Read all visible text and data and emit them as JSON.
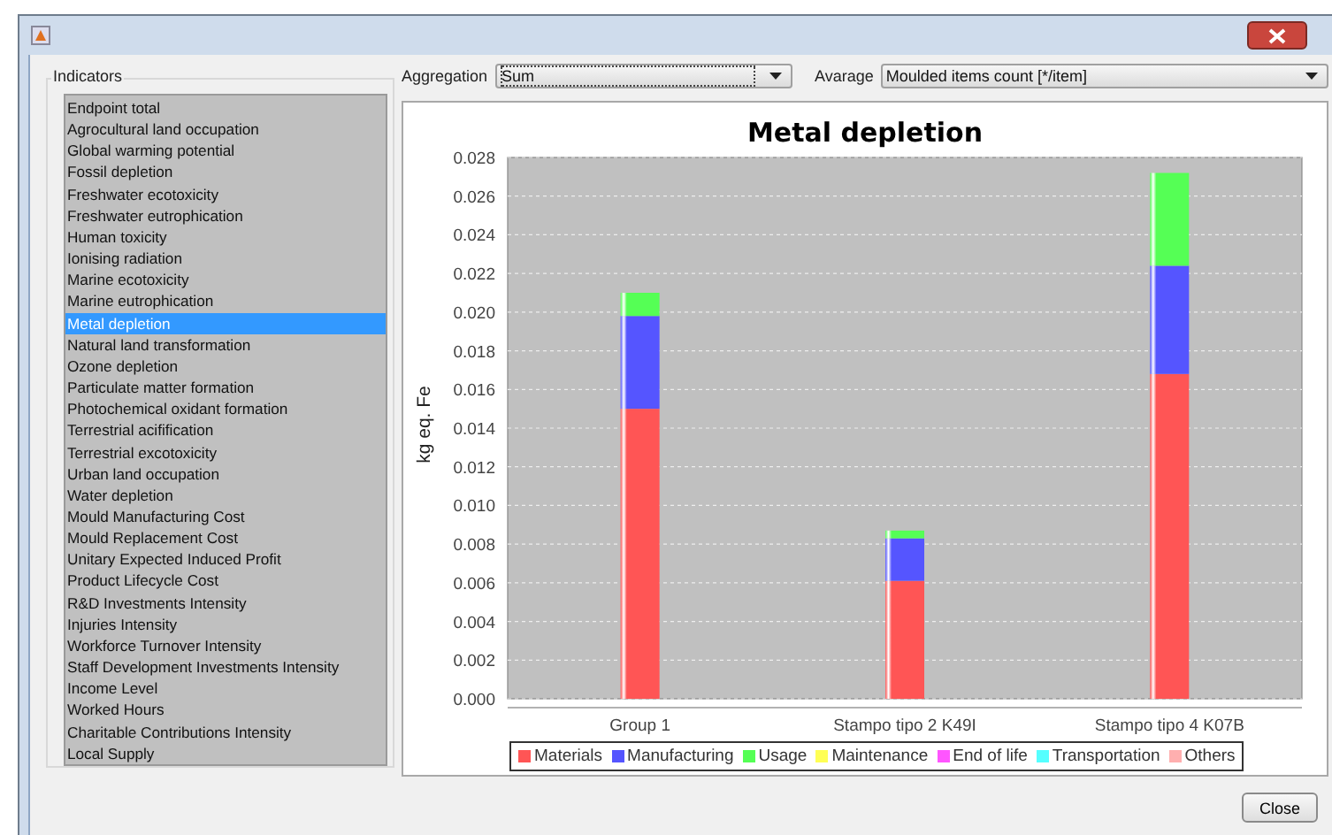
{
  "indicators": {
    "label": "Indicators",
    "items": [
      {
        "label": "Endpoint total",
        "selected": false
      },
      {
        "label": "Agrocultural land occupation",
        "selected": false
      },
      {
        "label": "Global warming potential",
        "selected": false
      },
      {
        "label": "Fossil depletion",
        "selected": false
      },
      {
        "label": "Freshwater ecotoxicity",
        "selected": false
      },
      {
        "label": "Freshwater eutrophication",
        "selected": false
      },
      {
        "label": "Human toxicity",
        "selected": false
      },
      {
        "label": "Ionising radiation",
        "selected": false
      },
      {
        "label": "Marine ecotoxicity",
        "selected": false
      },
      {
        "label": "Marine eutrophication",
        "selected": false
      },
      {
        "label": "Metal depletion",
        "selected": true
      },
      {
        "label": "Natural land transformation",
        "selected": false
      },
      {
        "label": "Ozone depletion",
        "selected": false
      },
      {
        "label": "Particulate matter formation",
        "selected": false
      },
      {
        "label": "Photochemical oxidant formation",
        "selected": false
      },
      {
        "label": "Terrestrial acifification",
        "selected": false
      },
      {
        "label": "Terrestrial excotoxicity",
        "selected": false
      },
      {
        "label": "Urban land occupation",
        "selected": false
      },
      {
        "label": "Water depletion",
        "selected": false
      },
      {
        "label": "Mould Manufacturing Cost",
        "selected": false
      },
      {
        "label": "Mould Replacement Cost",
        "selected": false
      },
      {
        "label": "Unitary Expected Induced Profit",
        "selected": false
      },
      {
        "label": "Product Lifecycle Cost",
        "selected": false
      },
      {
        "label": "R&D Investments Intensity",
        "selected": false
      },
      {
        "label": "Injuries Intensity",
        "selected": false
      },
      {
        "label": "Workforce Turnover Intensity",
        "selected": false
      },
      {
        "label": "Staff Development Investments Intensity",
        "selected": false
      },
      {
        "label": "Income Level",
        "selected": false
      },
      {
        "label": "Worked Hours",
        "selected": false
      },
      {
        "label": "Charitable Contributions Intensity",
        "selected": false
      },
      {
        "label": "Local Supply",
        "selected": false
      }
    ]
  },
  "aggregation": {
    "label": "Aggregation",
    "value": "Sum"
  },
  "average": {
    "label": "Avarage",
    "value": "Moulded items count [*/item]"
  },
  "chart": {
    "chart_data": {
      "type": "bar",
      "stacked": true,
      "title": "Metal depletion",
      "ylabel": "kg eq. Fe",
      "categories": [
        "Group 1",
        "Stampo tipo 2 K49I",
        "Stampo tipo 4 K07B"
      ],
      "ylim": [
        0,
        0.028
      ],
      "grid": true,
      "legend": "bottom",
      "yticks": [
        {
          "value": 0,
          "label": "0.000"
        },
        {
          "value": 0.002,
          "label": "0.002"
        },
        {
          "value": 0.004,
          "label": "0.004"
        },
        {
          "value": 0.006,
          "label": "0.006"
        },
        {
          "value": 0.008,
          "label": "0.008"
        },
        {
          "value": 0.01,
          "label": "0.010"
        },
        {
          "value": 0.012,
          "label": "0.012"
        },
        {
          "value": 0.014,
          "label": "0.014"
        },
        {
          "value": 0.016,
          "label": "0.016"
        },
        {
          "value": 0.018,
          "label": "0.018"
        },
        {
          "value": 0.02,
          "label": "0.020"
        },
        {
          "value": 0.022,
          "label": "0.022"
        },
        {
          "value": 0.024,
          "label": "0.024"
        },
        {
          "value": 0.026,
          "label": "0.026"
        },
        {
          "value": 0.028,
          "label": "0.028"
        }
      ],
      "series": [
        {
          "name": "Materials",
          "color": "#ff5555",
          "values": [
            0.015,
            0.0061,
            0.0168
          ]
        },
        {
          "name": "Manufacturing",
          "color": "#5555ff",
          "values": [
            0.0048,
            0.0022,
            0.0056
          ]
        },
        {
          "name": "Usage",
          "color": "#55ff55",
          "values": [
            0.0012,
            0.0004,
            0.0048
          ]
        },
        {
          "name": "Maintenance",
          "color": "#ffff55",
          "values": [
            0,
            0,
            0
          ]
        },
        {
          "name": "End of life",
          "color": "#ff55ff",
          "values": [
            0,
            0,
            0
          ]
        },
        {
          "name": "Transportation",
          "color": "#55ffff",
          "values": [
            0,
            0,
            0
          ]
        },
        {
          "name": "Others",
          "color": "#ffafaf",
          "values": [
            0,
            0,
            0
          ]
        }
      ]
    }
  },
  "close_button": "Close"
}
